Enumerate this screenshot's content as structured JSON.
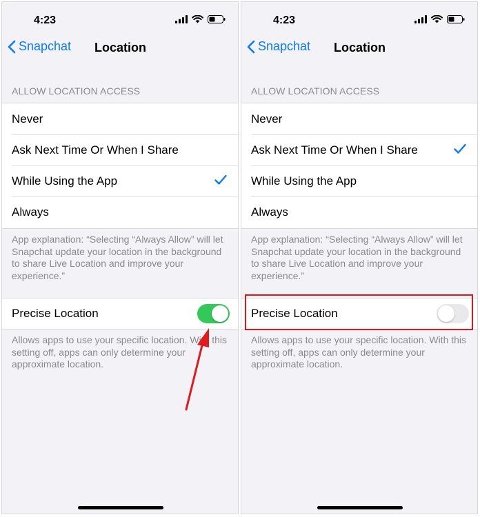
{
  "status_bar": {
    "time": "4:23"
  },
  "nav": {
    "back_label": "Snapchat",
    "title": "Location"
  },
  "section_header": "ALLOW LOCATION ACCESS",
  "options": [
    {
      "label": "Never"
    },
    {
      "label": "Ask Next Time Or When I Share"
    },
    {
      "label": "While Using the App"
    },
    {
      "label": "Always"
    }
  ],
  "explanation": "App explanation: “Selecting “Always Allow” will let Snapchat update your location in the background to share Live Location and improve your experience.”",
  "precise_location": {
    "label": "Precise Location"
  },
  "footer": "Allows apps to use your specific location. With this setting off, apps can only determine your approximate location.",
  "screens": [
    {
      "selected_option": "While Using the App",
      "precise_location_on": true
    },
    {
      "selected_option": "Ask Next Time Or When I Share",
      "precise_location_on": false
    }
  ],
  "colors": {
    "accent": "#0a7aff",
    "toggle_on": "#34c759",
    "toggle_off": "#e9e9eb",
    "annotation": "#d91a1a",
    "background": "#f2f2f7"
  }
}
